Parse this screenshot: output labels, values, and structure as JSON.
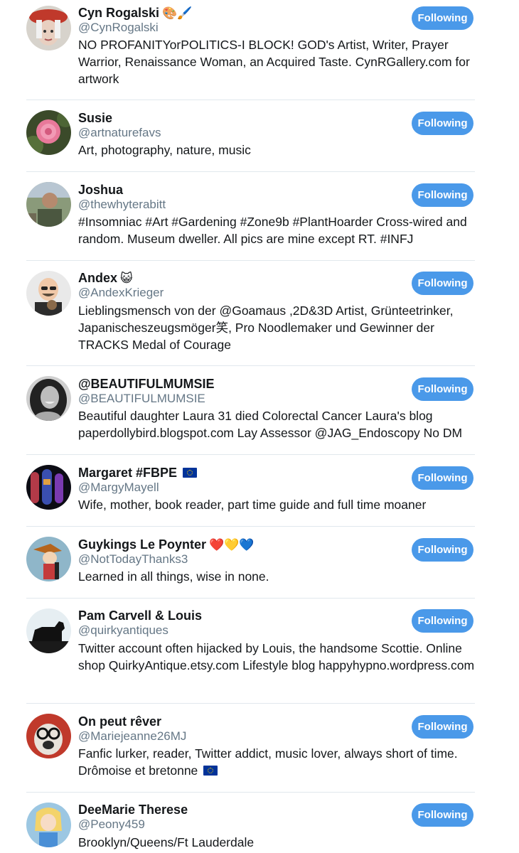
{
  "button_label": "Following",
  "users": [
    {
      "display_name": "Cyn Rogalski",
      "name_emoji": "🎨🖌️",
      "handle": "@CynRogalski",
      "bio": "NO PROFANITYorPOLITICS-I BLOCK! GOD's Artist, Writer, Prayer Warrior, Renaissance Woman, an Acquired Taste. CynRGallery.com for artwork",
      "avatar": "red-beret-portrait"
    },
    {
      "display_name": "Susie",
      "name_emoji": "",
      "handle": "@artnaturefavs",
      "bio": "Art, photography, nature, music",
      "avatar": "pink-rose"
    },
    {
      "display_name": "Joshua",
      "name_emoji": "",
      "handle": "@thewhyterabitt",
      "bio": "#Insomniac #Art #Gardening #Zone9b #PlantHoarder Cross-wired and random. Museum dweller. All pics are mine except RT. #INFJ",
      "avatar": "man-outdoors"
    },
    {
      "display_name": "Andex",
      "name_emoji": "😺",
      "handle": "@AndexKrieger",
      "bio": "Lieblingsmensch von der @Goamaus ,2D&3D Artist, Grünteetrinker, Japanischeszeugsmöger笑, Pro Noodlemaker und Gewinner der TRACKS Medal of Courage",
      "avatar": "cartoon-bald-man"
    },
    {
      "display_name": "@BEAUTIFULMUMSIE",
      "name_emoji": "",
      "handle": "@BEAUTIFULMUMSIE",
      "bio": "Beautiful daughter Laura 31 died Colorectal Cancer Laura's blog paperdollybird.blogspot.com Lay Assessor @JAG_Endoscopy No DM",
      "avatar": "woman-portrait-bw"
    },
    {
      "display_name": "Margaret #FBPE",
      "name_emoji": "",
      "name_flag": true,
      "handle": "@MargyMayell",
      "bio": "Wife, mother, book reader, part time guide and full time moaner",
      "avatar": "stained-glass"
    },
    {
      "display_name": "Guykings Le Poynter",
      "name_emoji": "❤️💛💙",
      "handle": "@NotTodayThanks3",
      "bio": "Learned in all things, wise in none.",
      "avatar": "cartoon-character"
    },
    {
      "display_name": "Pam Carvell & Louis",
      "name_emoji": "",
      "handle": "@quirkyantiques",
      "bio": "Twitter account often hijacked by Louis, the handsome Scottie. Online shop QuirkyAntique.etsy.com Lifestyle blog happyhypno.wordpress.com",
      "avatar": "scottie-silhouette"
    },
    {
      "display_name": "On peut rêver",
      "name_emoji": "",
      "handle": "@Mariejeanne26MJ",
      "bio": "Fanfic lurker, reader, Twitter addict, music lover, always short of time. Drômoise et bretonne",
      "bio_flag": true,
      "avatar": "dog-with-glasses"
    },
    {
      "display_name": "DeeMarie Therese",
      "name_emoji": "",
      "handle": "@Peony459",
      "bio": "Brooklyn/Queens/Ft Lauderdale",
      "avatar": "alice-cartoon"
    }
  ]
}
